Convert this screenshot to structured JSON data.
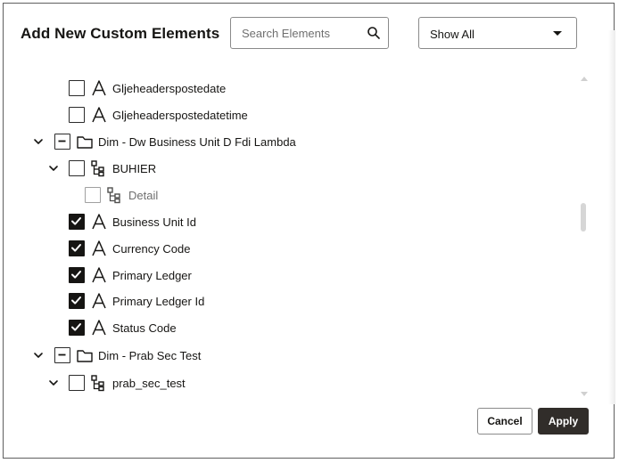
{
  "dialog": {
    "title": "Add New Custom Elements",
    "search": {
      "placeholder": "Search Elements",
      "value": "",
      "icon": "search-icon"
    },
    "filter": {
      "selected": "Show All",
      "icon": "chevron-down-icon"
    },
    "buttons": {
      "cancel": "Cancel",
      "apply": "Apply"
    },
    "colors": {
      "checked_fill": "#161513",
      "apply_bg": "#312d2a",
      "border": "#8a8a8a"
    }
  },
  "tree": {
    "items": [
      {
        "label": "Gljeheaderspostedate",
        "type": "attribute",
        "icon": "attribute-icon",
        "state": "unchecked",
        "expander": "none"
      },
      {
        "label": "Gljeheaderspostedatetime",
        "type": "attribute",
        "icon": "attribute-icon",
        "state": "unchecked",
        "expander": "none"
      },
      {
        "label": "Dim - Dw Business Unit D Fdi Lambda",
        "type": "folder",
        "icon": "folder-icon",
        "state": "partial",
        "expander": "expanded"
      },
      {
        "label": "BUHIER",
        "type": "hierarchy",
        "icon": "hierarchy-icon",
        "state": "unchecked",
        "expander": "expanded"
      },
      {
        "label": "Detail",
        "type": "hierarchy-level",
        "icon": "hierarchy-icon",
        "state": "disabled",
        "expander": "none"
      },
      {
        "label": "Business Unit Id",
        "type": "attribute",
        "icon": "attribute-icon",
        "state": "checked",
        "expander": "none"
      },
      {
        "label": "Currency Code",
        "type": "attribute",
        "icon": "attribute-icon",
        "state": "checked",
        "expander": "none"
      },
      {
        "label": "Primary Ledger",
        "type": "attribute",
        "icon": "attribute-icon",
        "state": "checked",
        "expander": "none"
      },
      {
        "label": "Primary Ledger Id",
        "type": "attribute",
        "icon": "attribute-icon",
        "state": "checked",
        "expander": "none"
      },
      {
        "label": "Status Code",
        "type": "attribute",
        "icon": "attribute-icon",
        "state": "checked",
        "expander": "none"
      },
      {
        "label": "Dim - Prab Sec Test",
        "type": "folder",
        "icon": "folder-icon",
        "state": "partial",
        "expander": "expanded"
      },
      {
        "label": "prab_sec_test",
        "type": "hierarchy",
        "icon": "hierarchy-icon",
        "state": "unchecked",
        "expander": "expanded"
      }
    ]
  }
}
